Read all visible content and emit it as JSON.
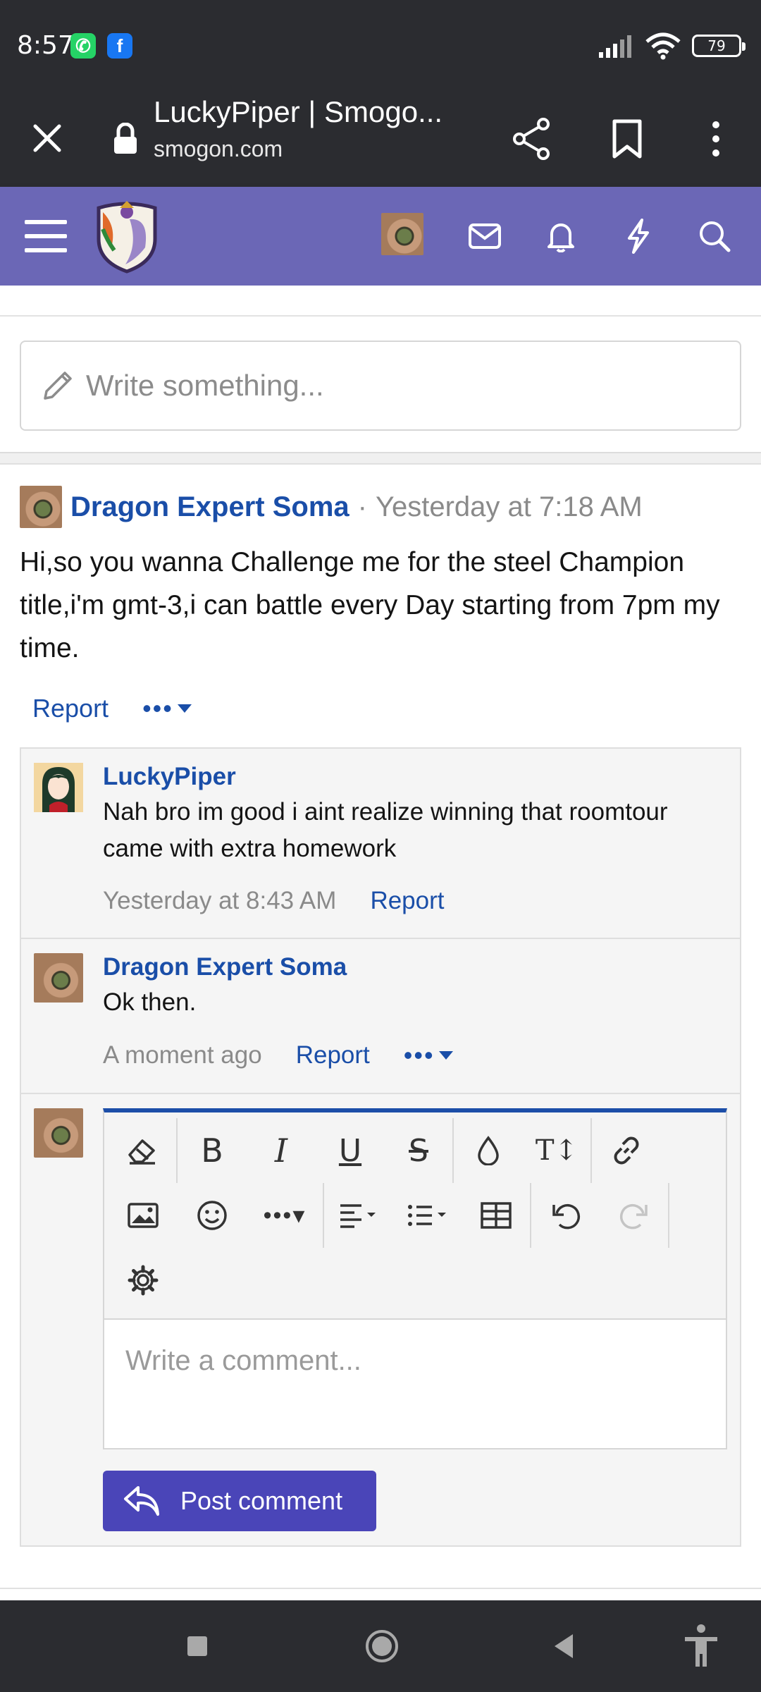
{
  "status_bar": {
    "time": "8:57",
    "battery": "79"
  },
  "browser": {
    "title": "LuckyPiper | Smogo...",
    "domain": "smogon.com"
  },
  "composer": {
    "placeholder": "Write something..."
  },
  "post": {
    "author": "Dragon Expert Soma",
    "separator": "·",
    "time": "Yesterday at 7:18 AM",
    "body": "Hi,so you wanna Challenge me for the steel Champion title,i'm gmt-3,i can battle every Day starting from 7pm my time.",
    "report_label": "Report",
    "more_label": "•••"
  },
  "comments": [
    {
      "author": "LuckyPiper",
      "text": "Nah bro im good i aint realize winning that roomtour came with extra homework",
      "time": "Yesterday at 8:43 AM",
      "report_label": "Report"
    },
    {
      "author": "Dragon Expert Soma",
      "text": "Ok then.",
      "time": "A moment ago",
      "report_label": "Report",
      "more_label": "•••"
    }
  ],
  "reply": {
    "placeholder": "Write a comment...",
    "post_button": "Post comment"
  },
  "colors": {
    "header": "#6b67b6",
    "link": "#1a4ea8",
    "button": "#4a45b8"
  }
}
